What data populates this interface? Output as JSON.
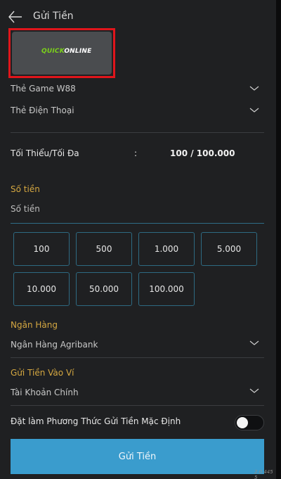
{
  "header": {
    "title": "Gửi Tiền"
  },
  "method": {
    "logo_quick": "QUICK",
    "logo_online": "ONLINE"
  },
  "selects": {
    "game_card": "Thẻ Game W88",
    "phone_card": "Thẻ Điện Thoại"
  },
  "limits": {
    "label": "Tối Thiểu/Tối Đa",
    "colon": ":",
    "value": "100 / 100.000"
  },
  "amount": {
    "label": "Số tiền",
    "placeholder": "Số tiền",
    "options": [
      "100",
      "500",
      "1.000",
      "5.000",
      "10.000",
      "50.000",
      "100.000"
    ]
  },
  "bank": {
    "label": "Ngân Hàng",
    "value": "Ngân Hàng Agribank"
  },
  "wallet": {
    "label": "Gửi Tiền Vào Ví",
    "value": "Tài Khoản Chính"
  },
  "default_method": {
    "label": "Đặt làm Phương Thức Gửi Tiền Mặc Định",
    "enabled": false
  },
  "submit": {
    "label": "Gửi Tiền"
  },
  "footer": {
    "version": "2.0.445 5"
  },
  "colors": {
    "accent": "#3a9ccd",
    "label_gold": "#d4a741",
    "highlight_red": "#e0151b",
    "background": "#1f2022"
  }
}
